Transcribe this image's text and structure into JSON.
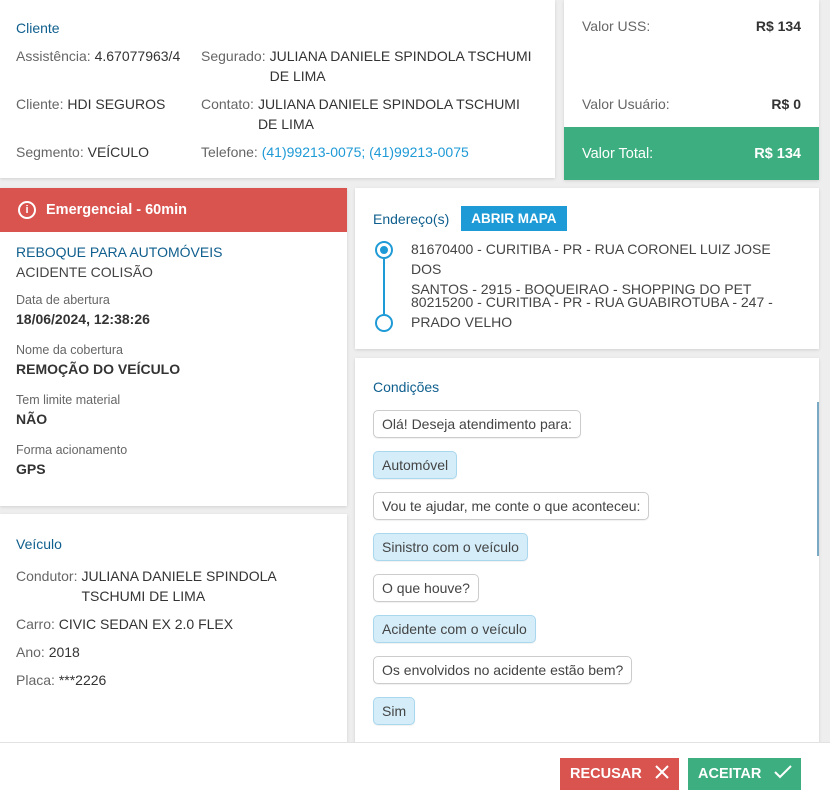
{
  "cliente": {
    "title": "Cliente",
    "assistencia_label": "Assistência:",
    "assistencia_value": "4.67077963/4",
    "cliente_label": "Cliente:",
    "cliente_value": "HDI SEGUROS",
    "segmento_label": "Segmento:",
    "segmento_value": "VEÍCULO",
    "segurado_label": "Segurado:",
    "segurado_line1": "JULIANA DANIELE SPINDOLA TSCHUMI",
    "segurado_line2": "DE LIMA",
    "contato_label": "Contato:",
    "contato_line1": "JULIANA DANIELE SPINDOLA TSCHUMI",
    "contato_line2": "DE LIMA",
    "telefone_label": "Telefone:",
    "telefone_value": "(41)99213-0075; (41)99213-0075"
  },
  "valores": {
    "uss_label": "Valor USS:",
    "uss_value": "R$ 134",
    "usuario_label": "Valor Usuário:",
    "usuario_value": "R$ 0",
    "total_label": "Valor Total:",
    "total_value": "R$ 134"
  },
  "servico": {
    "alert": "Emergencial - 60min",
    "alert_icon": "info-circle-icon",
    "title": "REBOQUE PARA AUTOMÓVEIS",
    "subtitle": "ACIDENTE COLISÃO",
    "data_label": "Data de abertura",
    "data_value": "18/06/2024, 12:38:26",
    "cobertura_label": "Nome da cobertura",
    "cobertura_value": "REMOÇÃO DO VEÍCULO",
    "limite_label": "Tem limite material",
    "limite_value": "NÃO",
    "forma_label": "Forma acionamento",
    "forma_value": "GPS"
  },
  "veiculo": {
    "title": "Veículo",
    "condutor_label": "Condutor:",
    "condutor_line1": "JULIANA DANIELE SPINDOLA",
    "condutor_line2": "TSCHUMI DE LIMA",
    "carro_label": "Carro:",
    "carro_value": "CIVIC SEDAN EX 2.0 FLEX",
    "ano_label": "Ano:",
    "ano_value": "2018",
    "placa_label": "Placa:",
    "placa_value": "***2226"
  },
  "endereco": {
    "title": "Endereço(s)",
    "map_button": "ABRIR MAPA",
    "origin_line1": "81670400 - CURITIBA - PR - RUA CORONEL LUIZ JOSE DOS",
    "origin_line2": "SANTOS - 2915 - BOQUEIRAO - SHOPPING DO PET",
    "dest_line1": "80215200 - CURITIBA - PR - RUA GUABIROTUBA - 247 -",
    "dest_line2": "PRADO VELHO"
  },
  "condicoes": {
    "title": "Condições",
    "messages": [
      {
        "text": "Olá! Deseja atendimento para:",
        "from": "bot"
      },
      {
        "text": "Automóvel",
        "from": "user"
      },
      {
        "text": "Vou te ajudar, me conte o que aconteceu:",
        "from": "bot"
      },
      {
        "text": "Sinistro com o veículo",
        "from": "user"
      },
      {
        "text": "O que houve?",
        "from": "bot"
      },
      {
        "text": "Acidente com o veículo",
        "from": "user"
      },
      {
        "text": "Os envolvidos no acidente estão bem?",
        "from": "bot"
      },
      {
        "text": "Sim",
        "from": "user"
      }
    ]
  },
  "footer": {
    "recusar": "RECUSAR",
    "aceitar": "ACEITAR",
    "recusar_icon": "close-icon",
    "aceitar_icon": "check-icon"
  },
  "colors": {
    "primary": "#1e9ad6",
    "title": "#0f5f8e",
    "danger": "#d9534f",
    "success": "#3dae7f"
  }
}
